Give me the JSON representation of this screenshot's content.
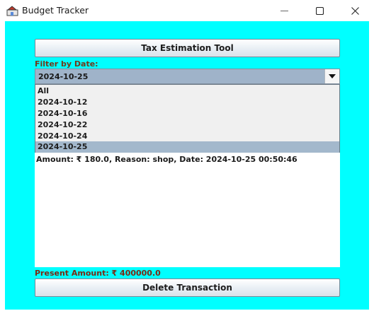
{
  "window": {
    "title": "Budget Tracker",
    "accent_background": "#00ffff"
  },
  "toolbar": {
    "tax_button_label": "Tax Estimation Tool"
  },
  "filter": {
    "label": "Filter by Date:",
    "selected": "2024-10-25",
    "options": [
      "All",
      "2024-10-12",
      "2024-10-16",
      "2024-10-22",
      "2024-10-24",
      "2024-10-25"
    ]
  },
  "transactions": [
    "Amount: ₹ 180.0, Reason: shop, Date: 2024-10-25 00:50:46"
  ],
  "summary": {
    "present_amount": "Present Amount: ₹ 400000.0"
  },
  "actions": {
    "delete_label": "Delete Transaction"
  },
  "icons": {
    "app": "app-icon",
    "minimize": "minimize-icon",
    "maximize": "maximize-icon",
    "close": "close-icon",
    "dropdown": "chevron-down-icon"
  }
}
